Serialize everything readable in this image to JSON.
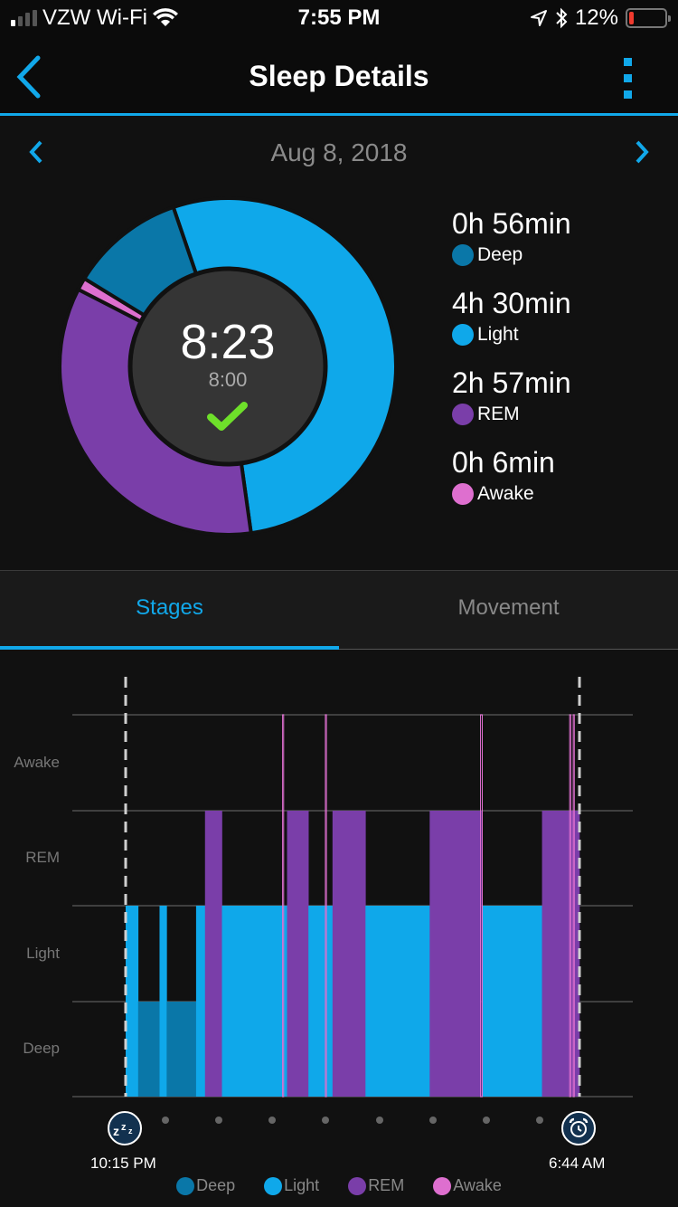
{
  "status_bar": {
    "carrier": "VZW Wi-Fi",
    "time": "7:55 PM",
    "battery": "12%",
    "battery_level": 0.12,
    "signal_bars": 1,
    "icons": [
      "signal-icon",
      "wifi-icon",
      "location-icon",
      "bluetooth-icon",
      "battery-icon"
    ]
  },
  "nav": {
    "title": "Sleep Details",
    "back_icon": "chevron-left-icon",
    "more_icon": "more-vertical-icon"
  },
  "date": {
    "label": "Aug 8, 2018",
    "prev_icon": "chevron-left-icon",
    "next_icon": "chevron-right-icon"
  },
  "summary": {
    "total": "8:23",
    "goal": "8:00",
    "goal_met_icon": "checkmark-icon",
    "stages": [
      {
        "key": "deep",
        "label": "Deep",
        "duration": "0h 56min",
        "minutes": 56
      },
      {
        "key": "light",
        "label": "Light",
        "duration": "4h 30min",
        "minutes": 270
      },
      {
        "key": "rem",
        "label": "REM",
        "duration": "2h 57min",
        "minutes": 177
      },
      {
        "key": "awake",
        "label": "Awake",
        "duration": "0h 6min",
        "minutes": 6
      }
    ]
  },
  "colors": {
    "accent": "#11a8ea",
    "deep": "#0a77a8",
    "light": "#0fa8ea",
    "rem": "#7a3ea9",
    "awake": "#de6fcf",
    "check": "#6ee02a"
  },
  "tabs": [
    {
      "label": "Stages",
      "active": true
    },
    {
      "label": "Movement",
      "active": false
    }
  ],
  "chart_data": {
    "type": "step",
    "title": "Sleep Stages",
    "ylabels": [
      "Awake",
      "REM",
      "Light",
      "Deep"
    ],
    "start_time": "10:15 PM",
    "end_time": "6:44 AM",
    "total_minutes": 509,
    "segments": [
      {
        "stage": "light",
        "start": 0,
        "end": 14
      },
      {
        "stage": "deep",
        "start": 14,
        "end": 38
      },
      {
        "stage": "light",
        "start": 38,
        "end": 46
      },
      {
        "stage": "deep",
        "start": 46,
        "end": 79
      },
      {
        "stage": "light",
        "start": 79,
        "end": 89
      },
      {
        "stage": "rem",
        "start": 89,
        "end": 108
      },
      {
        "stage": "light",
        "start": 108,
        "end": 181
      },
      {
        "stage": "awake",
        "start": 176,
        "end": 177
      },
      {
        "stage": "rem",
        "start": 181,
        "end": 205
      },
      {
        "stage": "light",
        "start": 205,
        "end": 232
      },
      {
        "stage": "awake",
        "start": 224,
        "end": 225
      },
      {
        "stage": "rem",
        "start": 232,
        "end": 269
      },
      {
        "stage": "light",
        "start": 269,
        "end": 341
      },
      {
        "stage": "rem",
        "start": 341,
        "end": 399
      },
      {
        "stage": "awake",
        "start": 398,
        "end": 400
      },
      {
        "stage": "light",
        "start": 400,
        "end": 467
      },
      {
        "stage": "rem",
        "start": 467,
        "end": 509
      },
      {
        "stage": "awake",
        "start": 498,
        "end": 499
      },
      {
        "stage": "awake",
        "start": 502,
        "end": 503
      }
    ],
    "x_tick_count": 8,
    "start_icon": "sleep-zzz-icon",
    "end_icon": "alarm-clock-icon",
    "legend": [
      {
        "key": "deep",
        "label": "Deep"
      },
      {
        "key": "light",
        "label": "Light"
      },
      {
        "key": "rem",
        "label": "REM"
      },
      {
        "key": "awake",
        "label": "Awake"
      }
    ],
    "legend_position": "bottom",
    "grid": true
  }
}
